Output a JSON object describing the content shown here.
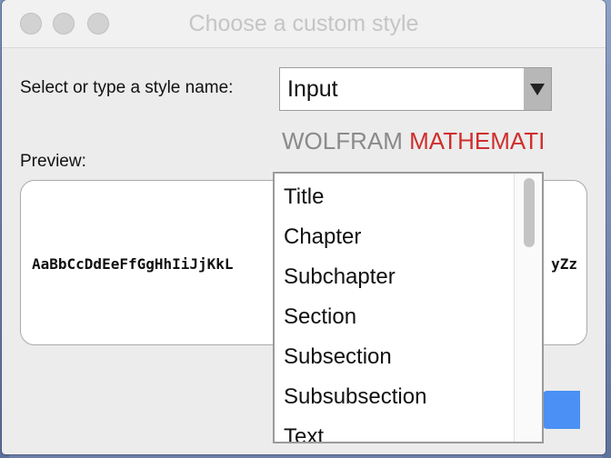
{
  "window": {
    "title": "Choose a custom style"
  },
  "form": {
    "style_label": "Select or type a style name:",
    "style_value": "Input",
    "preview_label": "Preview:"
  },
  "logo": {
    "word1": "WOLFRAM",
    "word2": "MATHEMATI"
  },
  "preview": {
    "sample_left": "AaBbCcDdEeFfGgHhIiJjKkL",
    "sample_right": "yZz"
  },
  "dropdown": {
    "options": [
      "Title",
      "Chapter",
      "Subchapter",
      "Section",
      "Subsection",
      "Subsubsection",
      "Text"
    ]
  },
  "colors": {
    "accent": "#4b90f4",
    "logo_red": "#cf2e2e",
    "logo_gray": "#8a8a8a"
  }
}
